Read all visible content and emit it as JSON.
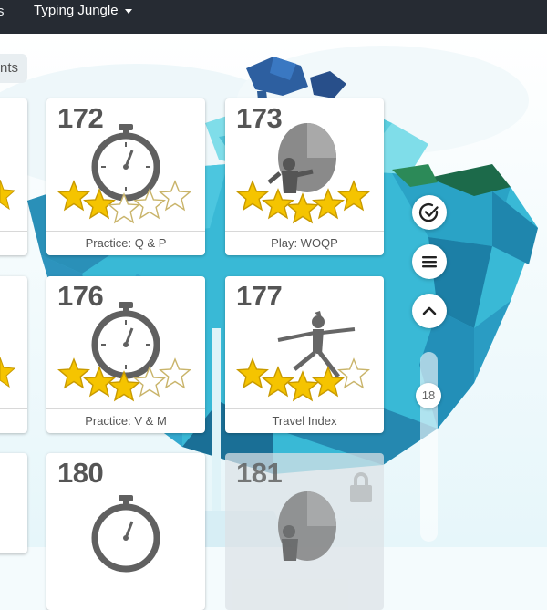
{
  "topbar": {
    "cut_item": "s",
    "dropdown_label": "Typing Jungle"
  },
  "pill_label": "nts",
  "cards": [
    {
      "number": "172",
      "label": "Practice: Q & P",
      "kind": "stopwatch",
      "stars": 2
    },
    {
      "number": "173",
      "label": "Play: WOQP",
      "kind": "balloon",
      "stars": 5
    },
    {
      "number": "176",
      "label": "Practice: V & M",
      "kind": "stopwatch",
      "stars": 3
    },
    {
      "number": "177",
      "label": "Travel Index",
      "kind": "dancer",
      "stars": 4
    },
    {
      "number": "180",
      "label": "",
      "kind": "stopwatch",
      "stars": 0
    },
    {
      "number": "181",
      "label": "",
      "kind": "balloon",
      "stars": 0,
      "locked": true
    }
  ],
  "controls": {
    "check_icon": "check-circle-icon",
    "menu_icon": "menu-icon",
    "up_icon": "chevron-up-icon"
  },
  "slider": {
    "value": "18"
  },
  "colors": {
    "topbar": "#262b33",
    "star_gold": "#f5c400",
    "icon_gray": "#606060",
    "water": "#39b9d6"
  }
}
